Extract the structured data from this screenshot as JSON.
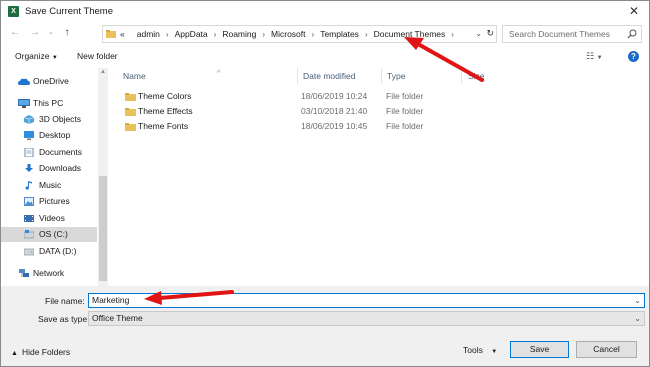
{
  "window": {
    "title": "Save Current Theme",
    "app_icon_letter": "X"
  },
  "address": {
    "crumbs": [
      "«",
      "admin",
      "AppData",
      "Roaming",
      "Microsoft",
      "Templates",
      "Document Themes"
    ],
    "search_placeholder": "Search Document Themes"
  },
  "toolbar": {
    "organize_label": "Organize",
    "new_folder_label": "New folder"
  },
  "nav_pane": {
    "items": [
      {
        "label": "OneDrive",
        "icon": "cloud-icon"
      },
      {
        "label": "This PC",
        "icon": "computer-icon"
      },
      {
        "label": "3D Objects",
        "icon": "cube-icon"
      },
      {
        "label": "Desktop",
        "icon": "desktop-icon"
      },
      {
        "label": "Documents",
        "icon": "documents-icon"
      },
      {
        "label": "Downloads",
        "icon": "download-icon"
      },
      {
        "label": "Music",
        "icon": "music-icon"
      },
      {
        "label": "Pictures",
        "icon": "pictures-icon"
      },
      {
        "label": "Videos",
        "icon": "videos-icon"
      },
      {
        "label": "OS (C:)",
        "icon": "drive-icon"
      },
      {
        "label": "DATA (D:)",
        "icon": "drive-icon"
      },
      {
        "label": "Network",
        "icon": "network-icon"
      }
    ],
    "selected": "OS (C:)"
  },
  "file_list": {
    "columns": [
      "Name",
      "Date modified",
      "Type",
      "Size"
    ],
    "rows": [
      {
        "name": "Theme Colors",
        "date": "18/06/2019 10:24",
        "type": "File folder",
        "size": ""
      },
      {
        "name": "Theme Effects",
        "date": "03/10/2018 21:40",
        "type": "File folder",
        "size": ""
      },
      {
        "name": "Theme Fonts",
        "date": "18/06/2019 10:45",
        "type": "File folder",
        "size": ""
      }
    ]
  },
  "fields": {
    "file_name_label": "File name:",
    "file_name_value": "Marketing",
    "save_as_type_label": "Save as type:",
    "save_as_type_value": "Office Theme"
  },
  "footer": {
    "hide_folders_label": "Hide Folders",
    "tools_label": "Tools",
    "save_label": "Save",
    "cancel_label": "Cancel"
  },
  "colors": {
    "annotation_arrow": "#e01414",
    "accent": "#0078d7",
    "folder": "#e8c15a"
  }
}
